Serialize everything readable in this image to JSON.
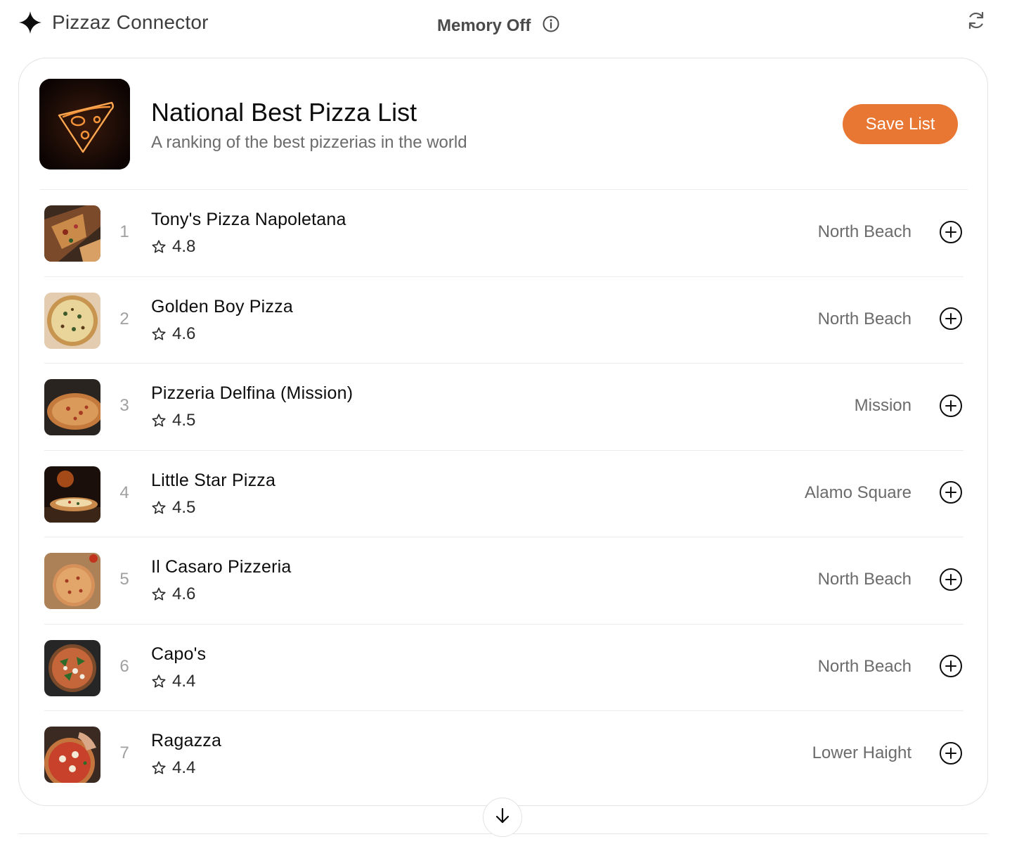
{
  "app": {
    "title": "Pizzaz Connector",
    "memory_status": "Memory Off",
    "icons": {
      "brand": "sparkle-icon",
      "info": "info-icon",
      "refresh": "refresh-icon",
      "scroll": "arrow-down-icon"
    }
  },
  "list": {
    "title": "National Best Pizza List",
    "subtitle": "A ranking of the best pizzerias in the world",
    "save_label": "Save List",
    "accent_color": "#e87734",
    "items": [
      {
        "rank": "1",
        "name": "Tony's Pizza Napoletana",
        "rating": "4.8",
        "location": "North Beach"
      },
      {
        "rank": "2",
        "name": "Golden Boy Pizza",
        "rating": "4.6",
        "location": "North Beach"
      },
      {
        "rank": "3",
        "name": "Pizzeria Delfina (Mission)",
        "rating": "4.5",
        "location": "Mission"
      },
      {
        "rank": "4",
        "name": "Little Star Pizza",
        "rating": "4.5",
        "location": "Alamo Square"
      },
      {
        "rank": "5",
        "name": "Il Casaro Pizzeria",
        "rating": "4.6",
        "location": "North Beach"
      },
      {
        "rank": "6",
        "name": "Capo's",
        "rating": "4.4",
        "location": "North Beach"
      },
      {
        "rank": "7",
        "name": "Ragazza",
        "rating": "4.4",
        "location": "Lower Haight"
      }
    ]
  }
}
